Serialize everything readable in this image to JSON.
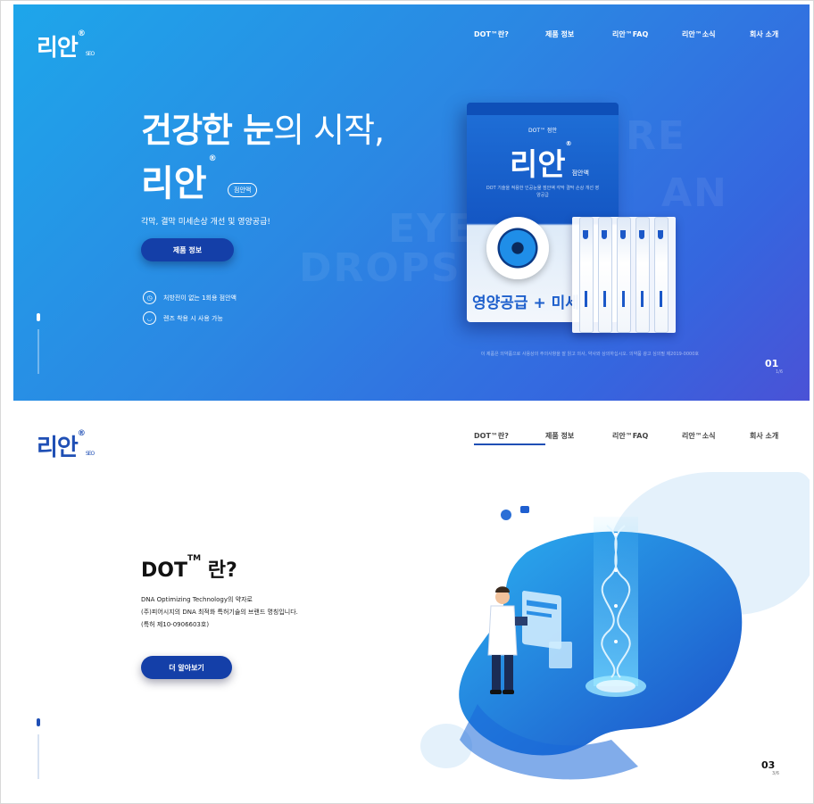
{
  "header": {
    "logo": "리안",
    "logo_sub": "SEO",
    "nav": [
      "DOT™란?",
      "제품 정보",
      "리안™FAQ",
      "리안™소식",
      "회사 소개"
    ]
  },
  "hero": {
    "headline_bold": "건강한 눈",
    "headline_rest": "의 시작,",
    "brand": "리안",
    "badge": "점안액",
    "subtitle": "각막, 결막 미세손상 개선 및 영양공급!",
    "cta": "제품 정보",
    "features": [
      {
        "icon": "clock-icon",
        "text": "처방전이 없는 1회용 점안액"
      },
      {
        "icon": "lens-icon",
        "text": "렌즈 착용 시 사용 가능"
      }
    ],
    "caption": "이 제품은 의약품으로 사용상의 주의사항을 잘 읽고 의사, 약사와 상의하십시오. 의약품 광고 심의필 제2019-0000호",
    "bg_words": [
      "EYE",
      "DROPS",
      "RE",
      "AN"
    ],
    "slide_number": "01",
    "slide_sub": "1/6"
  },
  "product": {
    "small_label": "DOT™ 점안",
    "name": "리안",
    "name_sub": "점안액",
    "desc": "DOT 기술을 적용한 인공눈물 점안액 각막 결막 손상 개선 영양공급",
    "bottom_text": "영양공급 + 미세",
    "vial_count": 5
  },
  "section2": {
    "title": "DOT",
    "title_sup": "TM",
    "title_suffix": " 란?",
    "lines": [
      "DNA Optimizing Technology의 약자로",
      "(주)피어시지의 DNA 최적화 특허기술의 브랜드 명칭입니다.",
      "(특허 제10-0906603호)"
    ],
    "cta": "더 알아보기",
    "slide_number": "03",
    "slide_sub": "3/6"
  },
  "colors": {
    "hero_start": "#1ea6ea",
    "hero_end": "#4a52d6",
    "button": "#143fa8",
    "accent": "#1f4fb5"
  }
}
